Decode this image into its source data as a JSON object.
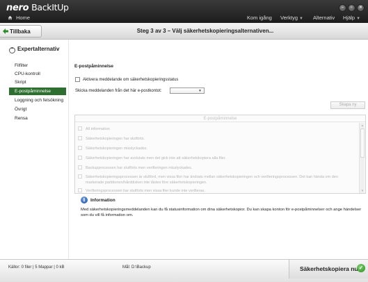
{
  "app": {
    "logo_brand": "nero",
    "logo_product": "BackItUp"
  },
  "titlebar": {
    "home_label": "Home",
    "menu": [
      {
        "label": "Kom igång",
        "has_caret": false
      },
      {
        "label": "Verktyg",
        "has_caret": true
      },
      {
        "label": "Alternativ",
        "has_caret": false
      },
      {
        "label": "Hjälp",
        "has_caret": true
      }
    ],
    "window_buttons": [
      "minimize-icon",
      "restore-icon",
      "close-icon"
    ]
  },
  "stepbar": {
    "back_label": "Tillbaka",
    "title": "Steg 3 av 3 – Välj säkerhetskopieringsalternativen..."
  },
  "sidebar": {
    "section_label": "Expertalternativ",
    "items": [
      {
        "label": "Filfilter",
        "selected": false
      },
      {
        "label": "CPU-kontroll",
        "selected": false
      },
      {
        "label": "Skript",
        "selected": false
      },
      {
        "label": "E-postpåminnelse",
        "selected": true
      },
      {
        "label": "Loggning och felsökning",
        "selected": false
      },
      {
        "label": "Övrigt",
        "selected": false
      },
      {
        "label": "Rensa",
        "selected": false
      }
    ]
  },
  "email": {
    "section_title": "E-postpåminnelse",
    "enable_label": "Aktivera meddelande om säkerhetskopieringsstatus",
    "account_label": "Skicka meddelanden från det här e-postkontot:",
    "account_value": "",
    "create_button": "Skapa ny",
    "list_header": "E-postpåminnelse",
    "list_items": [
      "All information",
      "Säkerhetskopieringen har slutförts.",
      "Säkerhetskopieringen misslyckades.",
      "Säkerhetskopieringen har avslutats men det gick inte att säkerhetskopiera alla filer.",
      "Backupprocessen har slutförts men verifieringen misslyckades.",
      "Säkerhetskopieringsprocessen är slutförd, men vissa filer har ändrats mellan säkerhetskopieringen och verifieringsprocessen. Det kan hända om den markerade partitionen/hårddisken inte låstes före säkerhetskopieringen.",
      "Verifieringsprocessen har slutförts men vissa filer kunde inte verifieras."
    ]
  },
  "info": {
    "title": "Information",
    "text": "Med säkerhetskopieringsmeddelanden kan du få statusinformation om dina säkerhetskopior. Du kan skapa konton för e-postpåminnelser och ange händelser som du vill få information om."
  },
  "statusbar": {
    "source_text": "Källor: 0  filer | 5 Mappar | 0 kB",
    "target_text": "Mål: D:\\Backup",
    "backup_button": "Säkerhetskopiera nu"
  },
  "colors": {
    "accent_green": "#2d6f2f",
    "titlebar": "#2a2a2a"
  }
}
